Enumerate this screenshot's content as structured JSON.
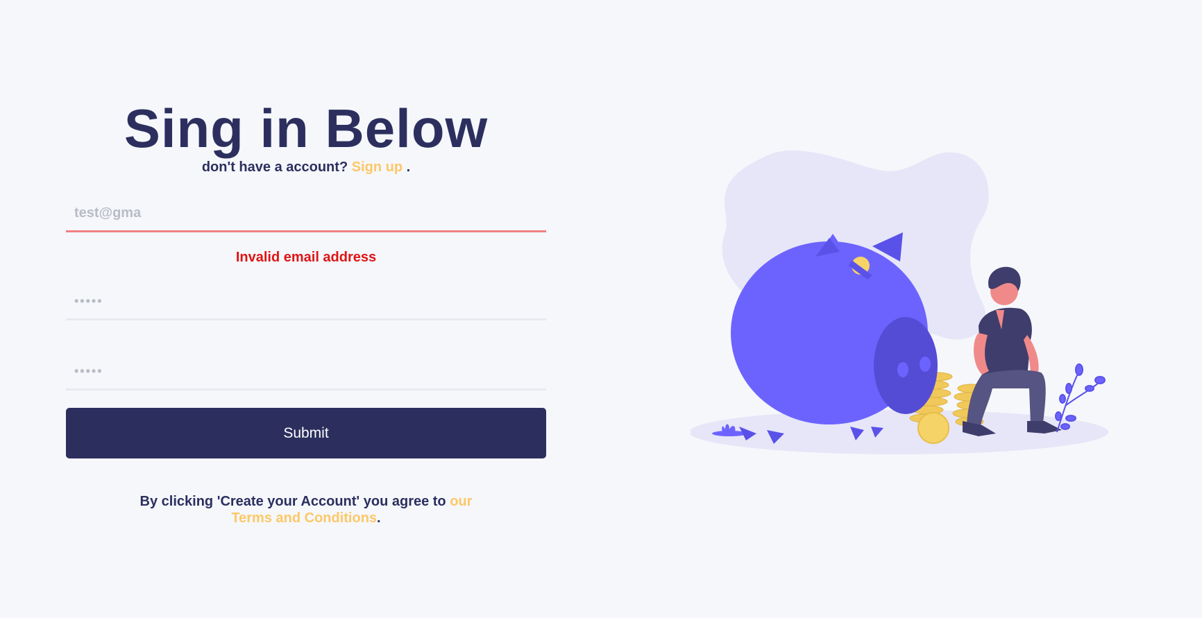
{
  "heading": {
    "title": "Sing in Below",
    "subtitle_prefix": "don't have a account?",
    "signup_link": "Sign up",
    "subtitle_suffix": "."
  },
  "form": {
    "email": {
      "value": "",
      "placeholder": "test@gma"
    },
    "error_message": "Invalid email address",
    "password": {
      "value": "",
      "placeholder": "•••••"
    },
    "confirm_password": {
      "value": "",
      "placeholder": "•••••"
    },
    "submit_label": "Submit"
  },
  "terms": {
    "prefix": "By clicking 'Create your Account' you agree to",
    "link": "our Terms and Conditions",
    "suffix": "."
  },
  "colors": {
    "primary": "#2c2f5e",
    "accent": "#fcc867",
    "error": "#e01414",
    "illustration_purple": "#6c63ff"
  },
  "illustration": {
    "icon": "piggy-bank-illustration"
  }
}
